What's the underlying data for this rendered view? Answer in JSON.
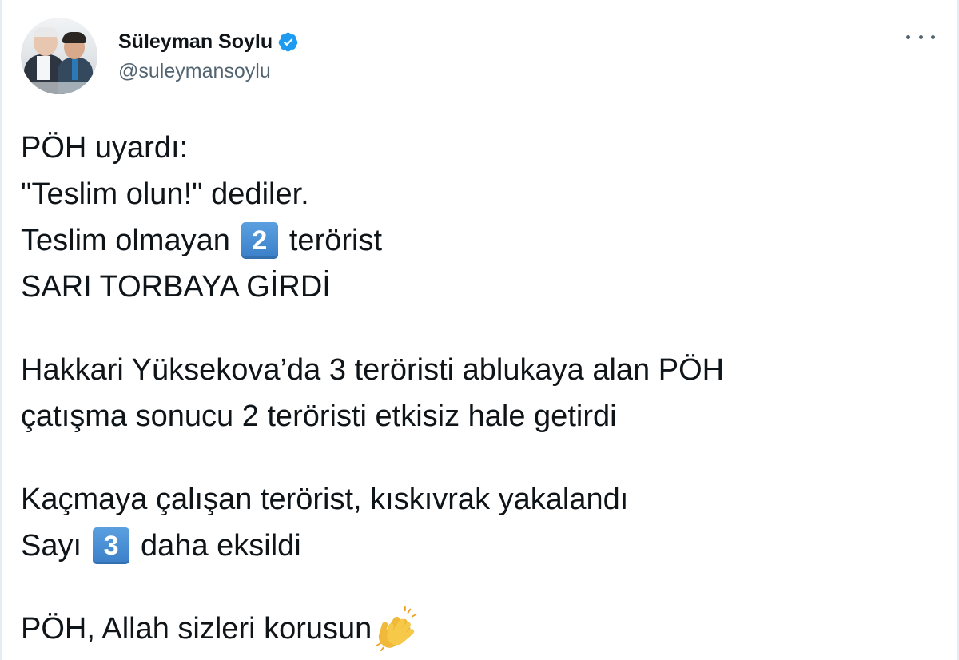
{
  "tweet": {
    "author": {
      "display_name": "Süleyman Soylu",
      "handle": "@suleymansoylu",
      "verified": true,
      "verified_color": "#1d9bf0"
    },
    "menu_icon": "more-horizontal-icon",
    "lines": {
      "l1": "PÖH uyardı:",
      "l2": "\"Teslim olun!\" dediler.",
      "l3_before": "Teslim olmayan",
      "l3_keycap": "2",
      "l3_after": "terörist",
      "l4": "SARI TORBAYA GİRDİ",
      "l5": "Hakkari Yüksekova’da 3 teröristi ablukaya alan PÖH",
      "l6": "çatışma sonucu 2 teröristi etkisiz hale getirdi",
      "l7": "Kaçmaya çalışan terörist, kıskıvrak yakalandı",
      "l8_before": "Sayı",
      "l8_keycap": "3",
      "l8_after": "daha eksildi",
      "l9": "PÖH, Allah sizleri korusun",
      "l9_emoji": "clapping-hands-icon"
    },
    "colors": {
      "text": "#0f1419",
      "secondary": "#536471",
      "keycap": "#3b7fc8"
    }
  }
}
